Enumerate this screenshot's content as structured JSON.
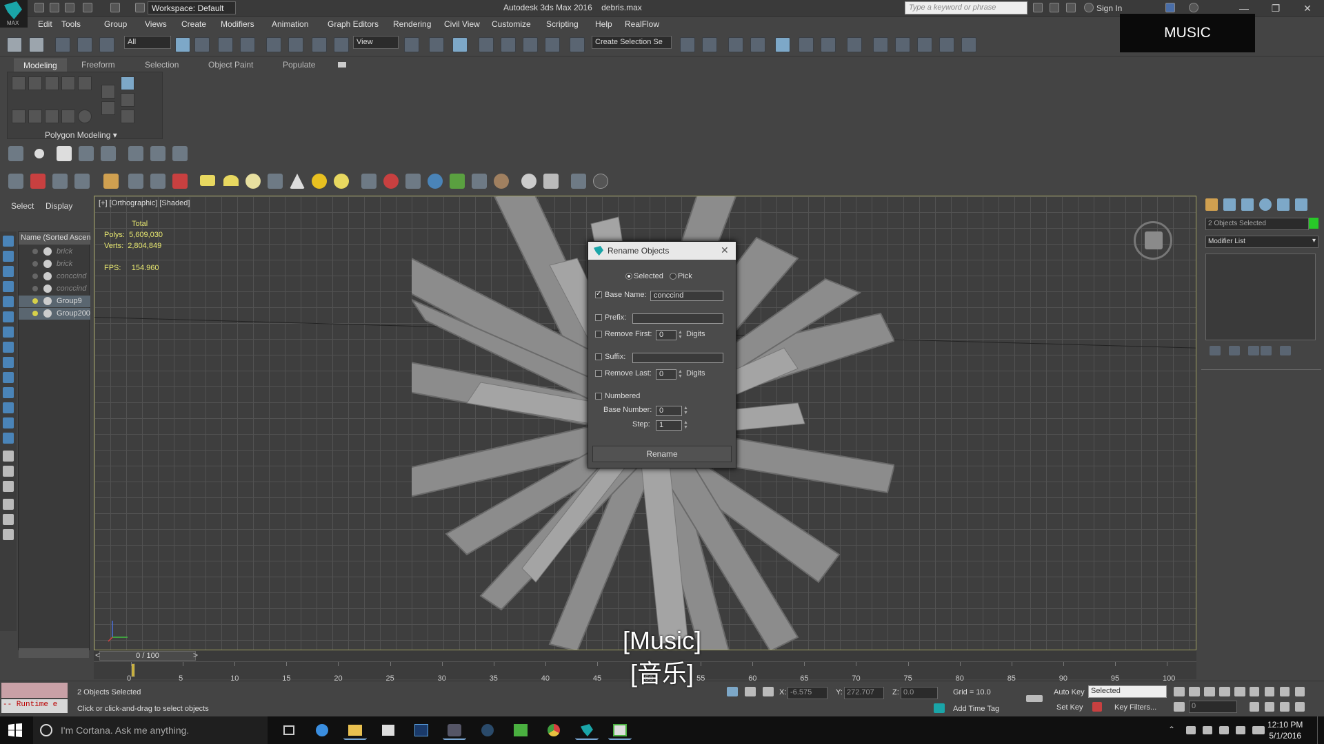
{
  "app": {
    "logo_text": "MAX",
    "title": "Autodesk 3ds Max 2016",
    "filename": "debris.max",
    "workspace": "Workspace: Default",
    "search_placeholder": "Type a keyword or phrase",
    "sign_in": "Sign In"
  },
  "menu": [
    "Edit",
    "Tools",
    "Group",
    "Views",
    "Create",
    "Modifiers",
    "Animation",
    "Graph Editors",
    "Rendering",
    "Civil View",
    "Customize",
    "Scripting",
    "Help",
    "RealFlow"
  ],
  "toolbar": {
    "filter_value": "All",
    "refcoord_value": "View",
    "selection_set_placeholder": "Create Selection Se"
  },
  "overlay": {
    "music_label": "MUSIC",
    "subtitle_line1": "[Music]",
    "subtitle_line2": "[音乐]"
  },
  "ribbon": {
    "tabs": [
      "Modeling",
      "Freeform",
      "Selection",
      "Object Paint",
      "Populate"
    ],
    "panel_label": "Polygon Modeling"
  },
  "scene_explorer": {
    "tabs": [
      "Select",
      "Display"
    ],
    "header": "Name (Sorted Ascen",
    "items": [
      {
        "name": "brick",
        "selected": false
      },
      {
        "name": "brick",
        "selected": false
      },
      {
        "name": "conccind",
        "selected": false
      },
      {
        "name": "conccind",
        "selected": false
      },
      {
        "name": "Group9",
        "selected": true
      },
      {
        "name": "Group200",
        "selected": true
      }
    ]
  },
  "viewport": {
    "label": "[+] [Orthographic] [Shaded]",
    "stats": {
      "total_label": "Total",
      "polys_label": "Polys:",
      "polys": "5,609,030",
      "verts_label": "Verts:",
      "verts": "2,804,849",
      "fps_label": "FPS:",
      "fps": "154.960"
    }
  },
  "rename_dialog": {
    "title": "Rename Objects",
    "selected_label": "Selected",
    "pick_label": "Pick",
    "base_name_label": "Base Name:",
    "base_name_value": "conccind",
    "base_name_checked": true,
    "prefix_label": "Prefix:",
    "prefix_value": "",
    "remove_first_label": "Remove First:",
    "remove_first_value": "0",
    "digits_label": "Digits",
    "suffix_label": "Suffix:",
    "suffix_value": "",
    "remove_last_label": "Remove Last:",
    "remove_last_value": "0",
    "numbered_label": "Numbered",
    "base_number_label": "Base Number:",
    "base_number_value": "0",
    "step_label": "Step:",
    "step_value": "1",
    "rename_button": "Rename"
  },
  "command_panel": {
    "selection_label": "2 Objects Selected",
    "modifier_list": "Modifier List",
    "color_swatch": "#28c828"
  },
  "timeline": {
    "position": "0 / 100",
    "ticks": [
      "0",
      "5",
      "10",
      "15",
      "20",
      "25",
      "30",
      "35",
      "40",
      "45",
      "50",
      "55",
      "60",
      "65",
      "70",
      "75",
      "80",
      "85",
      "90",
      "95",
      "100"
    ]
  },
  "status": {
    "maxscript_text": "-- Runtime e",
    "objects_selected": "2 Objects Selected",
    "prompt": "Click or click-and-drag to select objects",
    "x_label": "X:",
    "x_value": "-6.575",
    "y_label": "Y:",
    "y_value": "272.707",
    "z_label": "Z:",
    "z_value": "0.0",
    "grid": "Grid = 10.0",
    "add_time_tag": "Add Time Tag",
    "auto_key": "Auto Key",
    "set_key": "Set Key",
    "selected_combo": "Selected",
    "key_filters": "Key Filters...",
    "frame_value": "0"
  },
  "taskbar": {
    "cortana_text": "I'm Cortana. Ask me anything.",
    "time": "12:10 PM",
    "date": "5/1/2016"
  }
}
